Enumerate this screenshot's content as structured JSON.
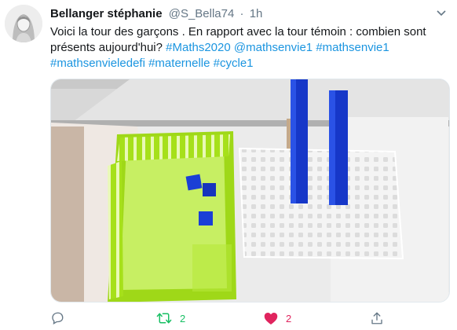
{
  "tweet": {
    "name": "Bellanger stéphanie",
    "handle": "@S_Bella74",
    "separator": "·",
    "time": "1h",
    "text_plain": "Voici la tour des garçons . En rapport avec la tour témoin : combien sont présents aujourd'hui? ",
    "hashtags_line1": [
      "#Maths2020",
      "@mathsenvie1",
      "#mathsenvie1"
    ],
    "hashtags_line2": [
      "#mathsenvieledefi",
      "#maternelle",
      "#cycle1"
    ]
  },
  "actions": {
    "reply_icon": "reply-icon",
    "retweet_count": "2",
    "like_count": "2",
    "share_icon": "share-icon"
  },
  "colors": {
    "link": "#1b95e0",
    "retweet": "#17bf63",
    "like": "#e0245e",
    "muted": "#657786"
  }
}
